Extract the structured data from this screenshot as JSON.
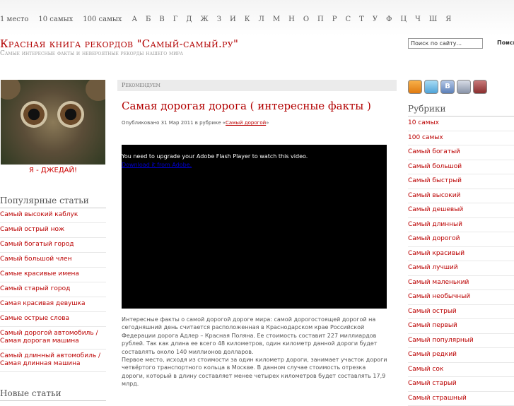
{
  "topnav": {
    "items": [
      "1 место",
      "10 самых",
      "100 самых",
      "А",
      "Б",
      "В",
      "Г",
      "Д",
      "Ж",
      "З",
      "И",
      "К",
      "Л",
      "М",
      "Н",
      "О",
      "П",
      "Р",
      "С",
      "Т",
      "У",
      "Ф",
      "Ц",
      "Ч",
      "Ш",
      "Я"
    ]
  },
  "header": {
    "title": "Красная книга рекордов \"Самый-самый.ру\"",
    "subtitle": "Самые интересные факты и невероятные рекорды нашего мира",
    "search_value": "Поиск по сайту...",
    "search_button": "Поиск"
  },
  "left": {
    "photo_caption": "Я - ДЖЕДАЙ!",
    "popular_title": "Популярные статьи",
    "popular": [
      "Самый высокий каблук",
      "Самый острый нож",
      "Самый богатый город",
      "Самый большой член",
      "Самые красивые имена",
      "Самый старый город",
      "Самая красивая девушка",
      "Самые острые слова",
      "Самый дорогой автомобиль / Самая дорогая машина",
      "Самый длинный автомобиль / Самая длинная машина"
    ],
    "new_title": "Новые статьи"
  },
  "main": {
    "recommend": "Рекомендуем",
    "post_title": "Самая дорогая дорога ( интересные факты )",
    "meta_prefix": "Опубликовано 31 Мар 2011 в рубрике «",
    "meta_category": "Самый дорогой",
    "meta_suffix": "»",
    "video_msg": "You need to upgrade your Adobe Flash Player to watch this video.",
    "video_link": "Download it from Adobe.",
    "para1": "Интересные факты о самой дорогой дороге мира: самой дорогостоящей дорогой на сегодняшний день считается расположенная в Краснодарском крае Российской Федерации дорога Адлер – Красная Поляна. Ее стоимость составит 227 миллиардов рублей. Так как длина ее всего 48 километров, один километр данной дороги будет составлять около 140 миллионов долларов.",
    "para2": "Первое место, исходя из стоимости за один километр дороги, занимает участок дороги четвёртого транспортного кольца в Москве. В данном случае стоимость отрезка дороги, который в длину составляет менее четырех километров будет составлять 17,9 млрд."
  },
  "right": {
    "icons": [
      "rss-icon",
      "twitter-icon",
      "vkontakte-icon",
      "livejournal-icon",
      "mail-icon"
    ],
    "vk_letter": "B",
    "rubrics_title": "Рубрики",
    "rubrics": [
      "10 самых",
      "100 самых",
      "Самый богатый",
      "Самый большой",
      "Самый быстрый",
      "Самый высокий",
      "Самый дешевый",
      "Самый длинный",
      "Самый дорогой",
      "Самый красивый",
      "Самый лучший",
      "Самый маленький",
      "Самый необычный",
      "Самый острый",
      "Самый первый",
      "Самый популярный",
      "Самый редкий",
      "Самый сок",
      "Самый старый",
      "Самый страшный"
    ]
  },
  "colors": {
    "accent": "#b20000",
    "link": "#bb0000",
    "text": "#555555"
  }
}
